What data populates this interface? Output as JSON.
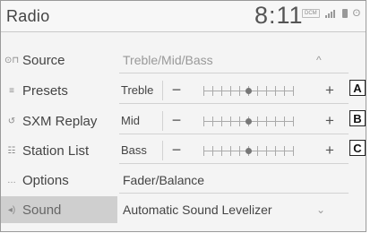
{
  "header": {
    "title": "Radio",
    "time": "8:11",
    "status_badge": "DCM",
    "bluetooth": "ʘ"
  },
  "sidebar": {
    "items": [
      {
        "icon": "source-icon",
        "glyph": "⊙⊓",
        "label": "Source"
      },
      {
        "icon": "presets-icon",
        "glyph": "≡",
        "label": "Presets"
      },
      {
        "icon": "replay-icon",
        "glyph": "↺",
        "label": "SXM Replay"
      },
      {
        "icon": "station-list-icon",
        "glyph": "☷",
        "label": "Station List"
      },
      {
        "icon": "options-icon",
        "glyph": "…",
        "label": "Options"
      },
      {
        "icon": "speaker-icon",
        "glyph": "◂)",
        "label": "Sound"
      }
    ],
    "active_index": 5
  },
  "panel": {
    "section": {
      "label": "Treble/Mid/Bass",
      "chevron": "^"
    },
    "rows": [
      {
        "label": "Treble",
        "minus": "−",
        "plus": "+",
        "level": 0.5,
        "callout": "A"
      },
      {
        "label": "Mid",
        "minus": "−",
        "plus": "+",
        "level": 0.5,
        "callout": "B"
      },
      {
        "label": "Bass",
        "minus": "−",
        "plus": "+",
        "level": 0.5,
        "callout": "C"
      }
    ],
    "fader": "Fader/Balance",
    "asl": {
      "label": "Automatic Sound Levelizer",
      "chevron": "⌄"
    }
  }
}
